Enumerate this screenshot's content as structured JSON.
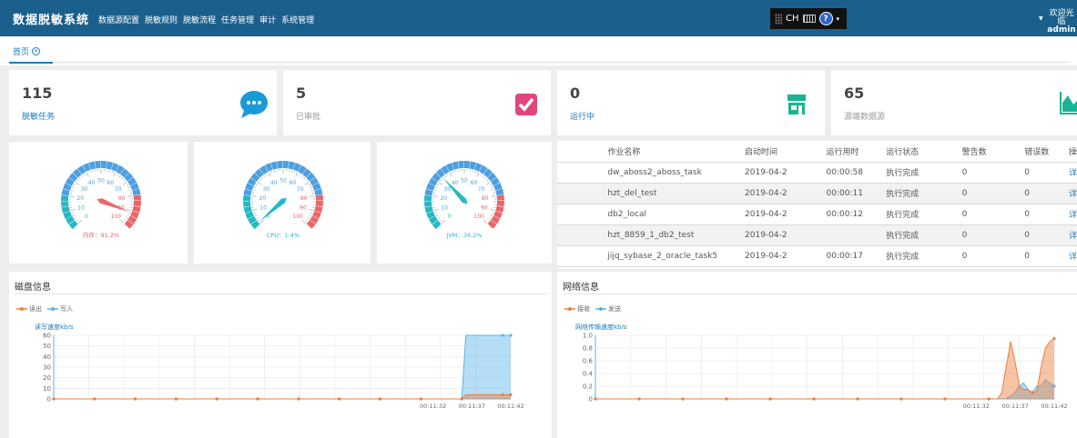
{
  "app": {
    "title": "数据脱敏系统"
  },
  "nav": [
    "数据源配置",
    "脱敏规则",
    "脱敏流程",
    "任务管理",
    "审计",
    "系统管理"
  ],
  "ime": {
    "label": "CH"
  },
  "user": {
    "greeting": "欢迎光临",
    "name": "admin"
  },
  "tabs": [
    {
      "label": "首页"
    }
  ],
  "stats": [
    {
      "value": "115",
      "label": "脱敏任务",
      "icon": "chat-bubble-icon",
      "color": "#1a9ad6"
    },
    {
      "value": "5",
      "label": "已审批",
      "icon": "checkbox-icon",
      "color": "#e2457b"
    },
    {
      "value": "0",
      "label": "运行中",
      "icon": "store-icon",
      "color": "#1ab394"
    },
    {
      "value": "65",
      "label": "源端数据源",
      "icon": "area-chart-icon",
      "color": "#1ab394"
    }
  ],
  "gauges": [
    {
      "label": "内存：91.2%",
      "value": 91.2,
      "ticks": [
        "0",
        "10",
        "20",
        "30",
        "40",
        "50",
        "60",
        "70",
        "80",
        "90",
        "100"
      ],
      "label_color": "#e8686a"
    },
    {
      "label": "CPU：1.4%",
      "value": 1.4,
      "ticks": [
        "0",
        "10",
        "20",
        "30",
        "40",
        "50",
        "60",
        "70",
        "80",
        "90",
        "100"
      ],
      "label_color": "#27b8c4"
    },
    {
      "label": "JVM：34.2%",
      "value": 34.2,
      "ticks": [
        "0",
        "10",
        "20",
        "30",
        "40",
        "50",
        "60",
        "70",
        "80",
        "90",
        "100"
      ],
      "label_color": "#27b8c4"
    }
  ],
  "jobs_table": {
    "headers": [
      "作业名称",
      "启动时间",
      "运行用时",
      "运行状态",
      "警告数",
      "错误数",
      "操"
    ],
    "rows": [
      {
        "name": "dw_aboss2_aboss_task",
        "start": "2019-04-2",
        "duration": "00:00:58",
        "status": "执行完成",
        "warnings": "0",
        "errors": "0",
        "action": "详"
      },
      {
        "name": "hzt_del_test",
        "start": "2019-04-2",
        "duration": "00:00:11",
        "status": "执行完成",
        "warnings": "0",
        "errors": "0",
        "action": "详"
      },
      {
        "name": "db2_local",
        "start": "2019-04-2",
        "duration": "00:00:12",
        "status": "执行完成",
        "warnings": "0",
        "errors": "0",
        "action": "详"
      },
      {
        "name": "hzt_8859_1_db2_test",
        "start": "2019-04-2",
        "duration": "",
        "status": "执行完成",
        "warnings": "0",
        "errors": "0",
        "action": "详"
      },
      {
        "name": "jijq_sybase_2_oracle_task5",
        "start": "2019-04-2",
        "duration": "00:00:17",
        "status": "执行完成",
        "warnings": "0",
        "errors": "0",
        "action": "详"
      }
    ]
  },
  "disk_panel": {
    "title": "磁盘信息"
  },
  "net_panel": {
    "title": "网络信息"
  },
  "chart_data": [
    {
      "type": "area",
      "ylabel": "读写速度kb/s",
      "ylim": [
        0,
        60
      ],
      "yticks": [
        "0",
        "10",
        "20",
        "30",
        "40",
        "50",
        "60"
      ],
      "x_tick_labels": [
        "00:11:32",
        "00:11:37",
        "00:11:42"
      ],
      "series": [
        {
          "name": "读出",
          "color": "#f07c3a",
          "values": [
            0,
            0,
            0,
            0,
            0,
            0,
            0,
            0,
            0,
            0,
            0,
            0,
            0,
            0,
            0,
            0,
            0,
            0,
            0,
            0,
            0,
            0,
            0,
            0,
            0,
            0,
            0,
            0,
            0,
            0,
            0,
            0,
            0,
            0,
            0,
            0,
            0,
            0,
            0,
            0,
            0,
            0,
            0,
            0,
            0,
            0,
            0,
            0,
            0,
            0,
            0,
            0,
            0,
            0,
            0,
            0,
            0,
            0,
            0,
            0,
            0,
            0,
            0,
            0,
            0,
            0,
            0,
            0,
            0,
            0,
            0,
            0,
            0,
            0,
            0,
            0,
            0,
            0,
            0,
            0,
            0,
            0,
            0,
            0,
            0,
            0,
            0,
            0,
            0,
            0,
            0,
            0,
            0,
            0,
            0,
            0,
            0,
            0,
            0,
            0,
            0,
            4,
            4,
            4,
            4,
            4,
            4,
            4,
            4,
            4,
            4,
            4,
            4
          ]
        },
        {
          "name": "写入",
          "color": "#5ab3e8",
          "values": [
            0,
            0,
            0,
            0,
            0,
            0,
            0,
            0,
            0,
            0,
            0,
            0,
            0,
            0,
            0,
            0,
            0,
            0,
            0,
            0,
            0,
            0,
            0,
            0,
            0,
            0,
            0,
            0,
            0,
            0,
            0,
            0,
            0,
            0,
            0,
            0,
            0,
            0,
            0,
            0,
            0,
            0,
            0,
            0,
            0,
            0,
            0,
            0,
            0,
            0,
            0,
            0,
            0,
            0,
            0,
            0,
            0,
            0,
            0,
            0,
            0,
            0,
            0,
            0,
            0,
            0,
            0,
            0,
            0,
            0,
            0,
            0,
            0,
            0,
            0,
            0,
            0,
            0,
            0,
            0,
            0,
            0,
            0,
            0,
            0,
            0,
            0,
            0,
            0,
            0,
            0,
            0,
            0,
            0,
            0,
            0,
            0,
            0,
            0,
            0,
            0,
            60,
            60,
            60,
            60,
            60,
            60,
            60,
            60,
            60,
            60,
            60,
            60
          ]
        }
      ],
      "grid": true
    },
    {
      "type": "area",
      "ylabel": "网络传输速度kb/s",
      "ylim": [
        0,
        1.0
      ],
      "yticks": [
        "0",
        "0.2",
        "0.4",
        "0.6",
        "0.8",
        "1.0"
      ],
      "x_tick_labels": [
        "00:11:32",
        "00:11:37",
        "00:11:42"
      ],
      "series": [
        {
          "name": "接收",
          "color": "#f07c3a",
          "values": [
            0,
            0,
            0,
            0,
            0,
            0,
            0,
            0,
            0,
            0,
            0,
            0,
            0,
            0,
            0,
            0,
            0,
            0,
            0,
            0,
            0,
            0,
            0,
            0,
            0,
            0,
            0,
            0,
            0,
            0,
            0,
            0,
            0,
            0,
            0,
            0,
            0,
            0,
            0,
            0,
            0,
            0,
            0,
            0,
            0,
            0,
            0,
            0,
            0,
            0,
            0,
            0,
            0,
            0,
            0,
            0,
            0,
            0,
            0,
            0,
            0,
            0,
            0,
            0,
            0,
            0,
            0,
            0,
            0,
            0,
            0,
            0,
            0,
            0,
            0,
            0,
            0,
            0,
            0,
            0,
            0,
            0,
            0,
            0,
            0,
            0,
            0,
            0,
            0,
            0,
            0,
            0,
            0,
            0.1,
            0.5,
            0.9,
            0.6,
            0.2,
            0.15,
            0.15,
            0.1,
            0.12,
            0.5,
            0.8,
            0.9,
            0.95
          ]
        },
        {
          "name": "发送",
          "color": "#5ab3e8",
          "values": [
            0,
            0,
            0,
            0,
            0,
            0,
            0,
            0,
            0,
            0,
            0,
            0,
            0,
            0,
            0,
            0,
            0,
            0,
            0,
            0,
            0,
            0,
            0,
            0,
            0,
            0,
            0,
            0,
            0,
            0,
            0,
            0,
            0,
            0,
            0,
            0,
            0,
            0,
            0,
            0,
            0,
            0,
            0,
            0,
            0,
            0,
            0,
            0,
            0,
            0,
            0,
            0,
            0,
            0,
            0,
            0,
            0,
            0,
            0,
            0,
            0,
            0,
            0,
            0,
            0,
            0,
            0,
            0,
            0,
            0,
            0,
            0,
            0,
            0,
            0,
            0,
            0,
            0,
            0,
            0,
            0,
            0,
            0,
            0,
            0,
            0,
            0,
            0,
            0,
            0,
            0,
            0,
            0,
            0,
            0,
            0.05,
            0.1,
            0.2,
            0.25,
            0.15,
            0.1,
            0.2,
            0.2,
            0.3,
            0.25,
            0.2
          ]
        }
      ],
      "grid": true
    }
  ]
}
